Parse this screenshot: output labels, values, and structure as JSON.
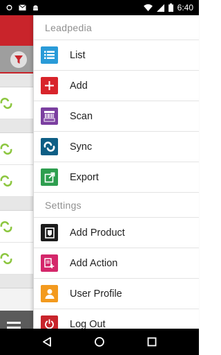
{
  "status_bar": {
    "time": "6:40",
    "left_icons": [
      "sync-status-icon",
      "email-icon",
      "android-icon"
    ],
    "right_icons": [
      "wifi-icon",
      "signal-icon",
      "battery-icon"
    ]
  },
  "background_app": {
    "header_color": "#c9242b",
    "filter_icon": "filter-icon",
    "menu_icon": "hamburger-menu-icon"
  },
  "drawer": {
    "sections": [
      {
        "title": "Leadpedia",
        "items": [
          {
            "label": "List",
            "icon": "list-icon",
            "color": "#2a9bd8"
          },
          {
            "label": "Add",
            "icon": "plus-icon",
            "color": "#d8242b"
          },
          {
            "label": "Scan",
            "icon": "scan-icon",
            "color": "#7b3fa0"
          },
          {
            "label": "Sync",
            "icon": "sync-icon",
            "color": "#0e5e85"
          },
          {
            "label": "Export",
            "icon": "export-icon",
            "color": "#2e9e4f"
          }
        ]
      },
      {
        "title": "Settings",
        "items": [
          {
            "label": "Add Product",
            "icon": "product-icon",
            "color": "#1c1c1c"
          },
          {
            "label": "Add Action",
            "icon": "add-action-icon",
            "color": "#d4276a"
          },
          {
            "label": "User Profile",
            "icon": "user-icon",
            "color": "#f39a1e"
          },
          {
            "label": "Log Out",
            "icon": "power-icon",
            "color": "#c8242b"
          }
        ]
      }
    ]
  },
  "nav_bar": {
    "buttons": [
      "back-icon",
      "home-icon",
      "recents-icon"
    ]
  }
}
